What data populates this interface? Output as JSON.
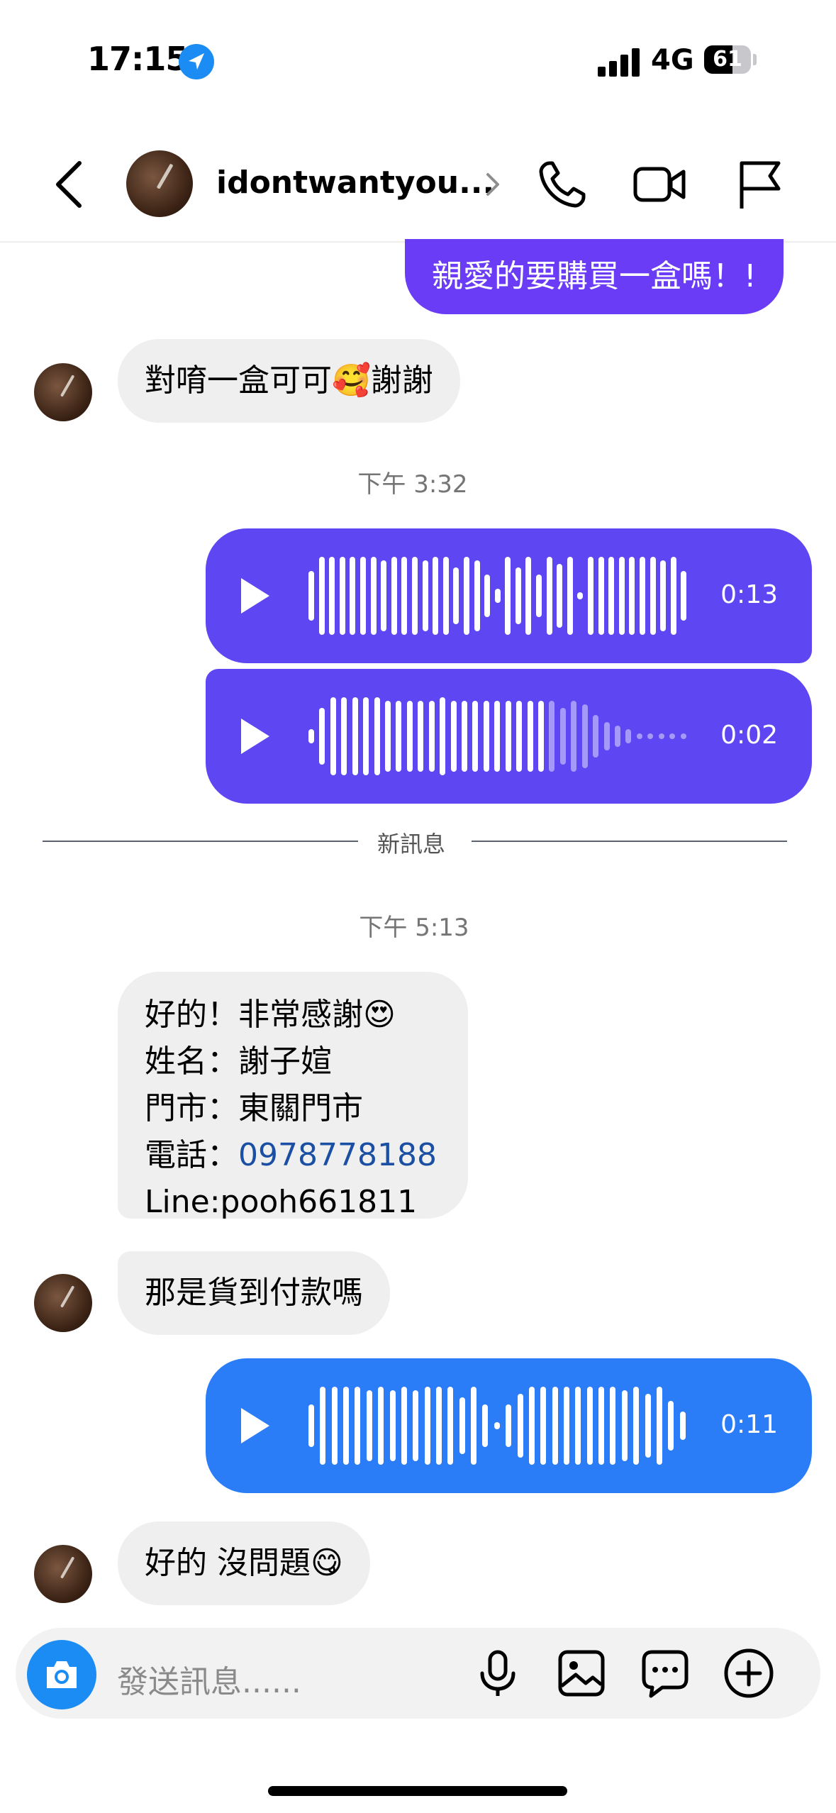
{
  "status_bar": {
    "time": "17:15",
    "network": "4G",
    "battery": "61",
    "battery_fraction": 0.61
  },
  "header": {
    "username": "idontwantyou...",
    "icons": [
      "back-chevron-icon",
      "chevron-right-icon",
      "phone-icon",
      "video-camera-icon",
      "flag-icon"
    ]
  },
  "messages": {
    "out_text_1": "親愛的要購買一盒嗎！!",
    "in_text_1": "對唷一盒可可🥰謝謝",
    "timestamp_1": "下午 3:32",
    "voice_1": {
      "duration": "0:13",
      "played_fraction": 1.0
    },
    "voice_2": {
      "duration": "0:02",
      "played_fraction": 0.6
    },
    "separator": "新訊息",
    "timestamp_2": "下午 5:13",
    "in_multi": {
      "line1": "好的！非常感謝😍",
      "line2": "姓名：謝子媗",
      "line3": "門市：東關門市",
      "line4_label": "電話：",
      "line4_phone": "0978778188",
      "line5": "Line:pooh661811"
    },
    "in_text_2": "那是貨到付款嗎",
    "voice_3": {
      "duration": "0:11",
      "played_fraction": 1.0
    },
    "in_text_3": "好的 沒問題😋"
  },
  "composer": {
    "placeholder": "發送訊息......",
    "icons": [
      "camera-icon",
      "microphone-icon",
      "image-icon",
      "sticker-chat-icon",
      "add-icon"
    ]
  },
  "colors": {
    "outgoing_purple": "#6a3cf5",
    "voice_purple": "#5e46f2",
    "voice_blue": "#2a7cf7",
    "incoming_gray": "#efefef",
    "phone_link": "#1a4fa3",
    "camera_blue": "#1b8cf3"
  }
}
